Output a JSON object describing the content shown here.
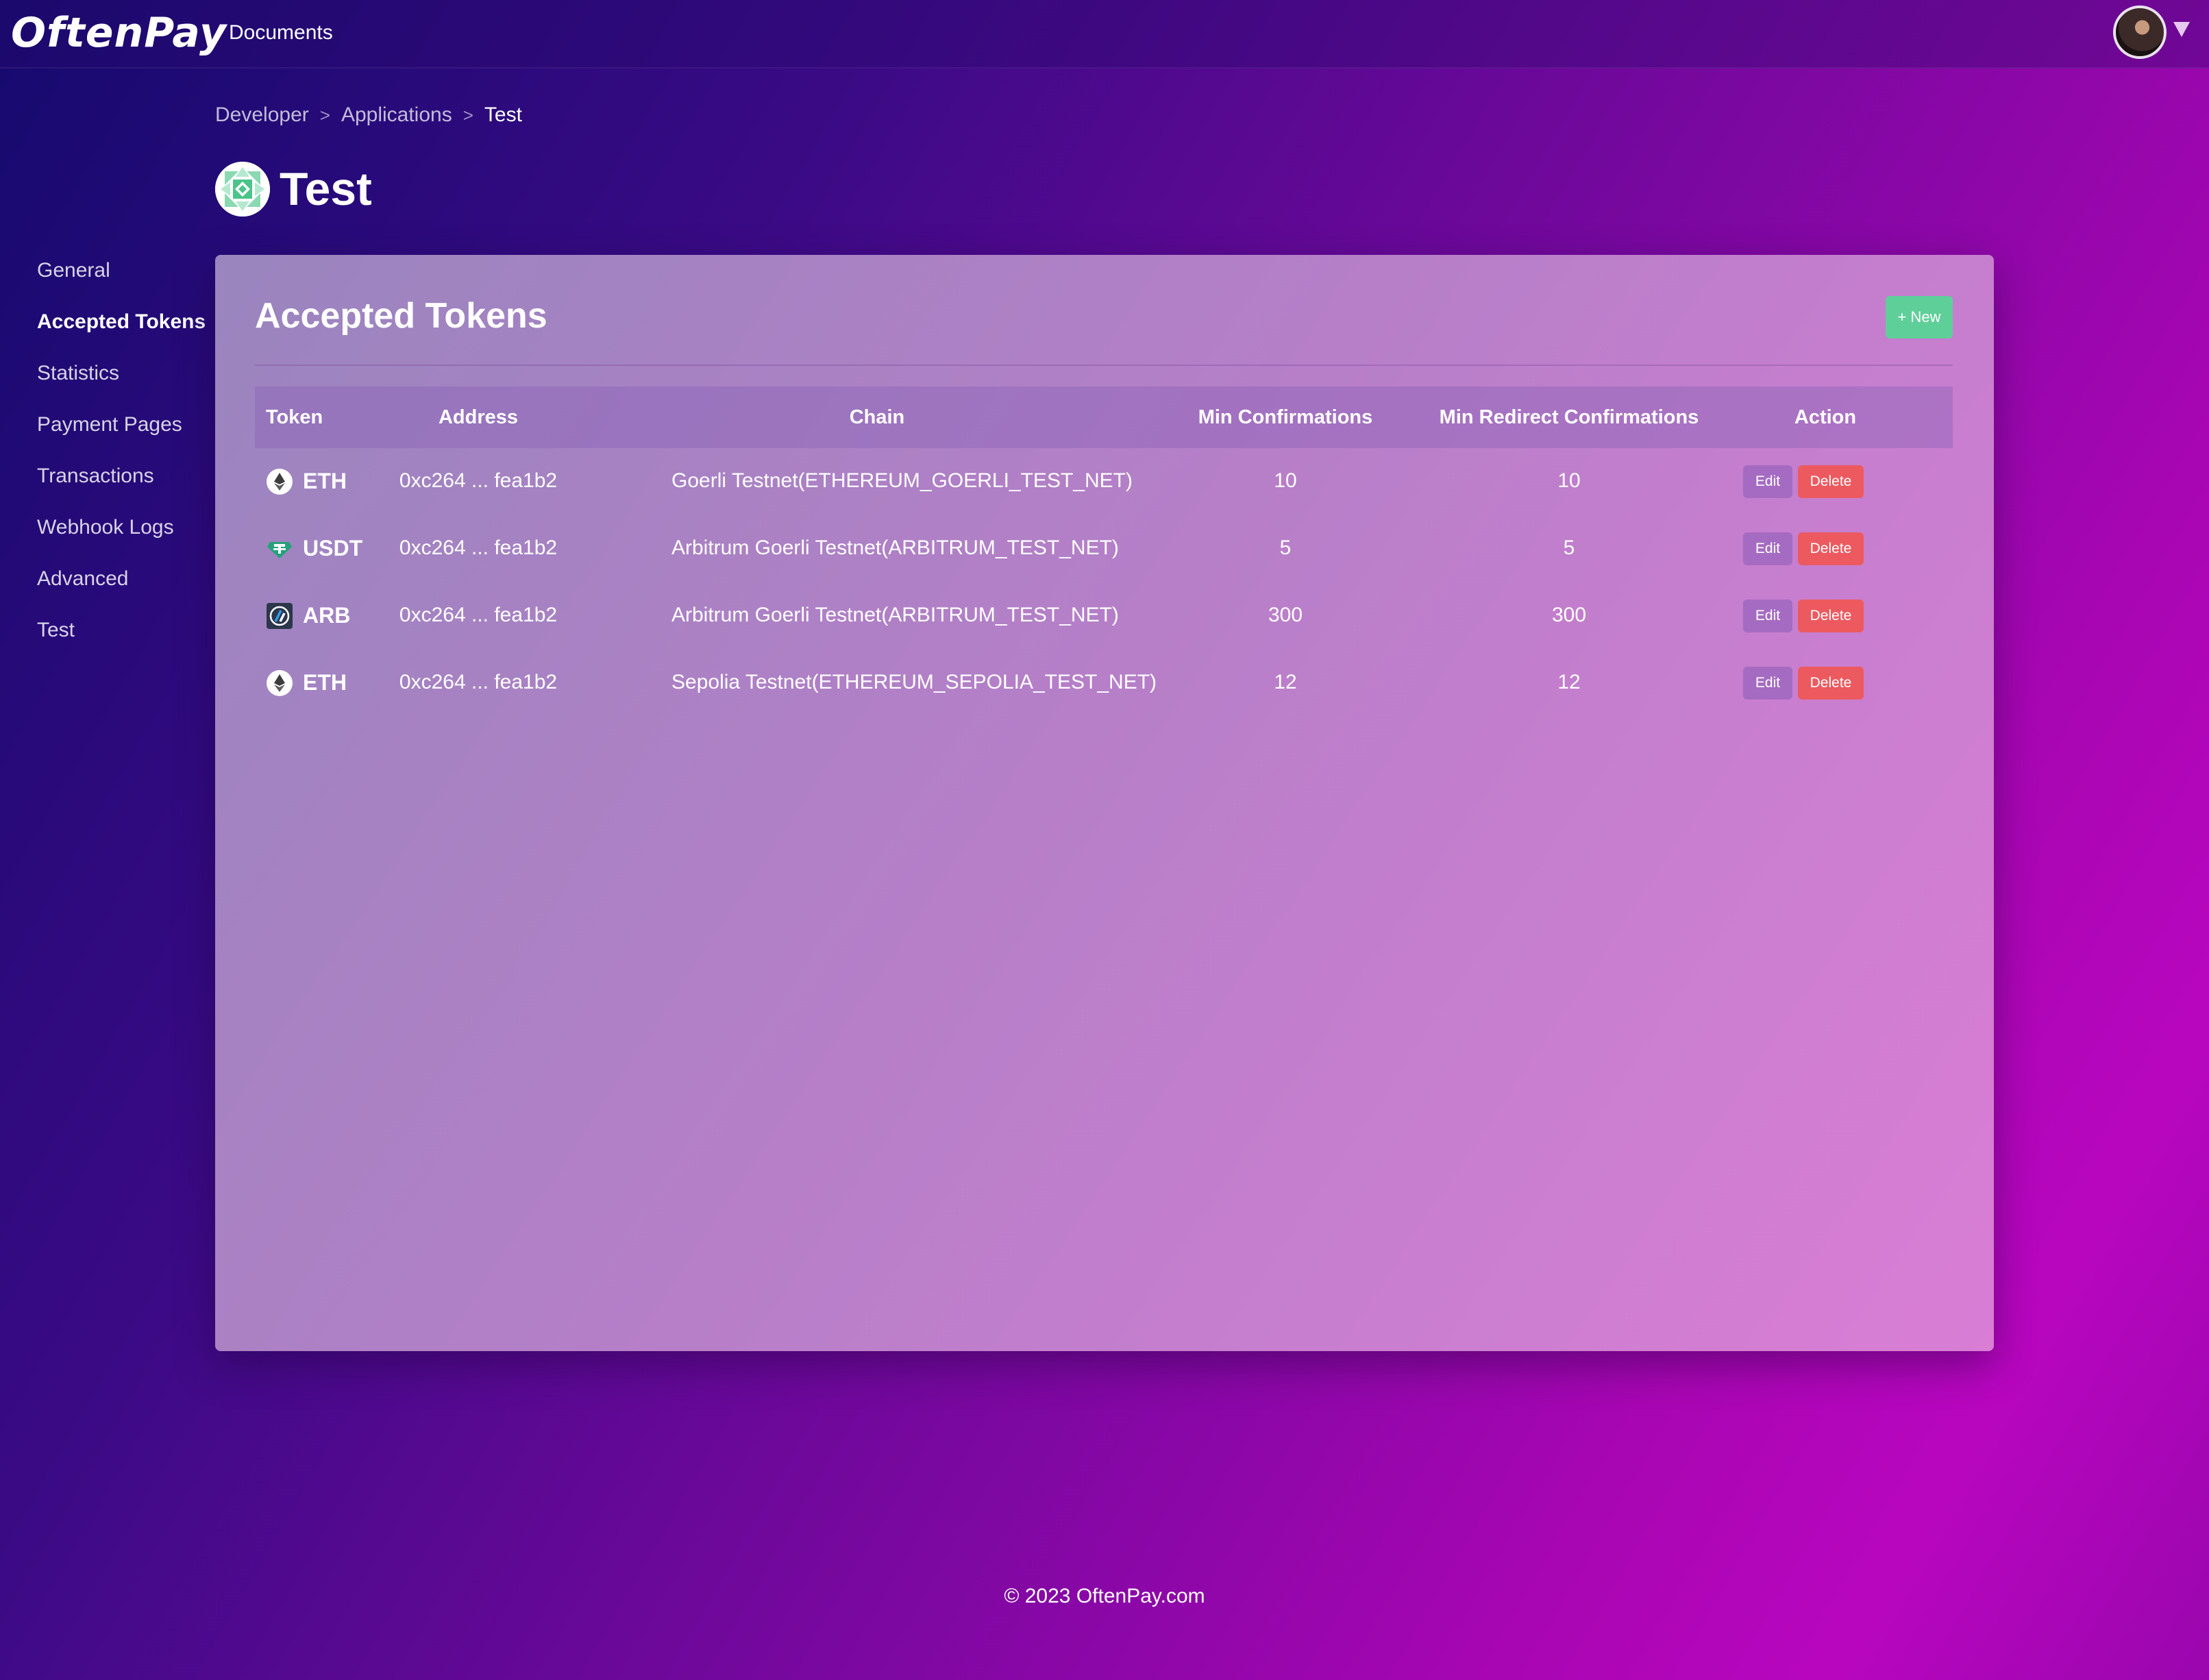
{
  "header": {
    "logo": "OftenPay",
    "nav_documents": "Documents"
  },
  "breadcrumb": {
    "items": [
      "Developer",
      "Applications",
      "Test"
    ],
    "separator": ">"
  },
  "app": {
    "title": "Test"
  },
  "sidebar": {
    "items": [
      {
        "label": "General",
        "active": false
      },
      {
        "label": "Accepted Tokens",
        "active": true
      },
      {
        "label": "Statistics",
        "active": false
      },
      {
        "label": "Payment Pages",
        "active": false
      },
      {
        "label": "Transactions",
        "active": false
      },
      {
        "label": "Webhook Logs",
        "active": false
      },
      {
        "label": "Advanced",
        "active": false
      },
      {
        "label": "Test",
        "active": false
      }
    ]
  },
  "card": {
    "title": "Accepted Tokens",
    "new_button": "+ New"
  },
  "table": {
    "headers": [
      "Token",
      "Address",
      "Chain",
      "Min Confirmations",
      "Min Redirect Confirmations",
      "Action"
    ],
    "rows": [
      {
        "token": "ETH",
        "icon": "ethereum-icon",
        "address": "0xc264 ... fea1b2",
        "chain": "Goerli Testnet(ETHEREUM_GOERLI_TEST_NET)",
        "min_conf": "10",
        "min_redirect": "10",
        "edit": "Edit",
        "delete": "Delete"
      },
      {
        "token": "USDT",
        "icon": "tether-icon",
        "address": "0xc264 ... fea1b2",
        "chain": "Arbitrum Goerli Testnet(ARBITRUM_TEST_NET)",
        "min_conf": "5",
        "min_redirect": "5",
        "edit": "Edit",
        "delete": "Delete"
      },
      {
        "token": "ARB",
        "icon": "arbitrum-icon",
        "address": "0xc264 ... fea1b2",
        "chain": "Arbitrum Goerli Testnet(ARBITRUM_TEST_NET)",
        "min_conf": "300",
        "min_redirect": "300",
        "edit": "Edit",
        "delete": "Delete"
      },
      {
        "token": "ETH",
        "icon": "ethereum-icon",
        "address": "0xc264 ... fea1b2",
        "chain": "Sepolia Testnet(ETHEREUM_SEPOLIA_TEST_NET)",
        "min_conf": "12",
        "min_redirect": "12",
        "edit": "Edit",
        "delete": "Delete"
      }
    ]
  },
  "footer": {
    "text": "© 2023 OftenPay.com"
  },
  "colors": {
    "new_button": "#5fcf9a",
    "edit_button": "#a56bc2",
    "delete_button": "#ec5a5f"
  }
}
